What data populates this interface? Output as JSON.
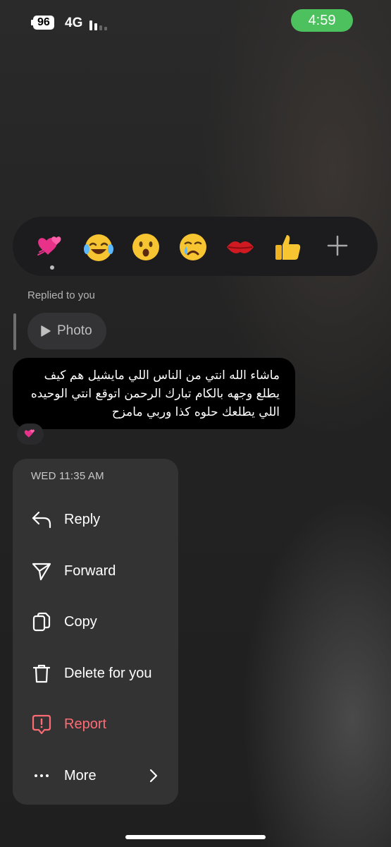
{
  "status_bar": {
    "battery": "96",
    "network": "4G",
    "time": "4:59"
  },
  "reactions": [
    {
      "name": "two-hearts"
    },
    {
      "name": "tears-of-joy"
    },
    {
      "name": "surprised"
    },
    {
      "name": "crying"
    },
    {
      "name": "kiss-mark"
    },
    {
      "name": "thumbs-up"
    }
  ],
  "replied_label": "Replied to you",
  "photo_label": "Photo",
  "message": {
    "text": "ماشاء الله انتي من الناس اللي مايشيل هم كيف يطلع وجهه بالكام تبارك الرحمن اتوقع انتي الوحيده اللي يطلعك حلوه كذا وربي مامزح",
    "reaction": "two-hearts"
  },
  "menu": {
    "timestamp": "WED 11:35 AM",
    "items": [
      {
        "label": "Reply",
        "icon": "reply-icon"
      },
      {
        "label": "Forward",
        "icon": "send-icon"
      },
      {
        "label": "Copy",
        "icon": "copy-icon"
      },
      {
        "label": "Delete for you",
        "icon": "trash-icon"
      },
      {
        "label": "Report",
        "icon": "report-icon"
      },
      {
        "label": "More",
        "icon": "more-icon"
      }
    ]
  },
  "colors": {
    "clock_pill": "#4cc15d",
    "report": "#ff6b75",
    "menu_bg": "#333333"
  }
}
